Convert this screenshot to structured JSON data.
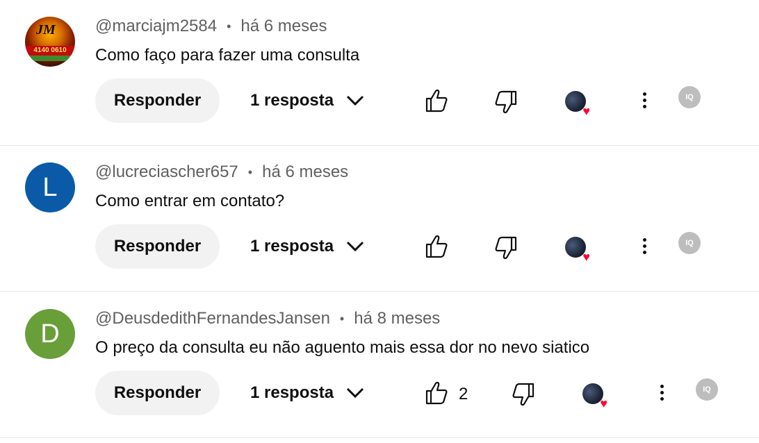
{
  "comments": [
    {
      "author": "@marciajm2584",
      "time": "há 6 meses",
      "text": "Como faço para fazer uma consulta",
      "avatar": {
        "type": "image",
        "logo_text": "JM",
        "strip_text": "4140 0610"
      },
      "reply_label": "Responder",
      "replies_label": "1 resposta",
      "like_count": ""
    },
    {
      "author": "@lucreciascher657",
      "time": "há 6 meses",
      "text": "Como entrar em contato?",
      "avatar": {
        "type": "letter",
        "letter": "L",
        "color": "#0b5aa8"
      },
      "reply_label": "Responder",
      "replies_label": "1 resposta",
      "like_count": ""
    },
    {
      "author": "@DeusdedithFernandesJansen",
      "time": "há 8 meses",
      "text": "O preço da consulta eu não aguento mais essa dor no nevo siatico",
      "avatar": {
        "type": "letter",
        "letter": "D",
        "color": "#689f38"
      },
      "reply_label": "Responder",
      "replies_label": "1 resposta",
      "like_count": "2"
    }
  ],
  "separator": "•",
  "icons": {
    "like": "thumb-up-icon",
    "dislike": "thumb-down-icon",
    "expand": "chevron-down-icon",
    "more": "more-vert-icon",
    "creator_heart": "creator-heart-icon",
    "extension": "extension-badge-icon"
  },
  "extension_badge_text": "IQ",
  "colors": {
    "meta": "#606060",
    "heart": "#ff0033",
    "button_bg": "#f2f2f2"
  }
}
